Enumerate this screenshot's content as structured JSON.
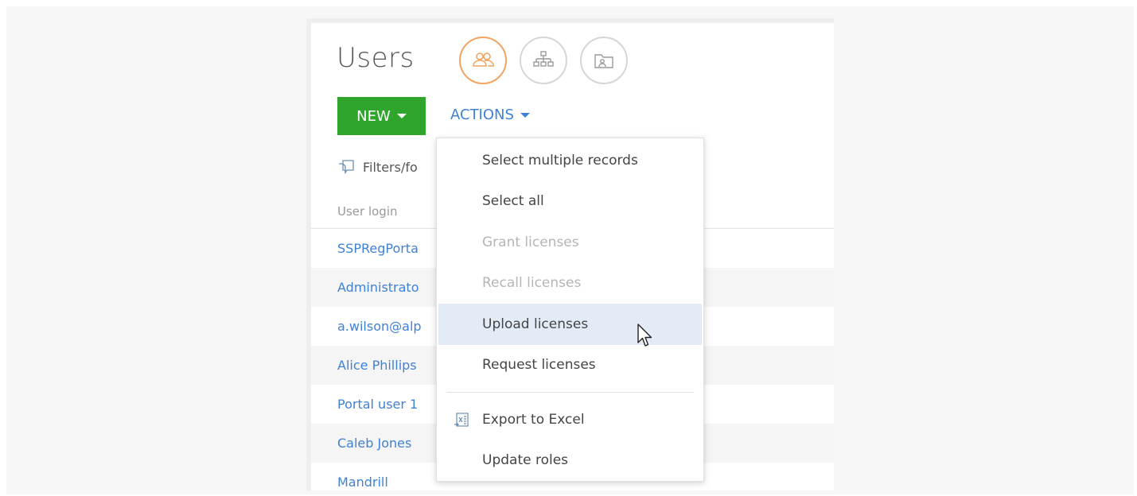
{
  "page": {
    "title": "Users",
    "view_buttons": [
      {
        "icon": "users-icon",
        "active": true
      },
      {
        "icon": "hierarchy-icon",
        "active": false
      },
      {
        "icon": "folder-user-icon",
        "active": false
      }
    ]
  },
  "toolbar": {
    "new_label": "NEW",
    "actions_label": "ACTIONS"
  },
  "filters": {
    "label": "Filters/fo"
  },
  "table": {
    "column_header": "User login",
    "rows": [
      "SSPRegPorta",
      "Administrato",
      "a.wilson@alp",
      "Alice Phillips",
      "Portal user 1",
      "Caleb Jones",
      "Mandrill"
    ]
  },
  "actions_menu": {
    "items": [
      {
        "label": "Select multiple records",
        "disabled": false
      },
      {
        "label": "Select all",
        "disabled": false
      },
      {
        "label": "Grant licenses",
        "disabled": true
      },
      {
        "label": "Recall licenses",
        "disabled": true
      },
      {
        "label": "Upload licenses",
        "disabled": false,
        "hovered": true
      },
      {
        "label": "Request licenses",
        "disabled": false
      }
    ],
    "items_after_separator": [
      {
        "label": "Export to Excel",
        "icon": "excel-export-icon"
      },
      {
        "label": "Update roles"
      }
    ]
  },
  "colors": {
    "accent_green": "#2fa52b",
    "link_blue": "#3f81d6",
    "active_orange": "#f4a460",
    "hover_bg": "#e3ebf7"
  }
}
